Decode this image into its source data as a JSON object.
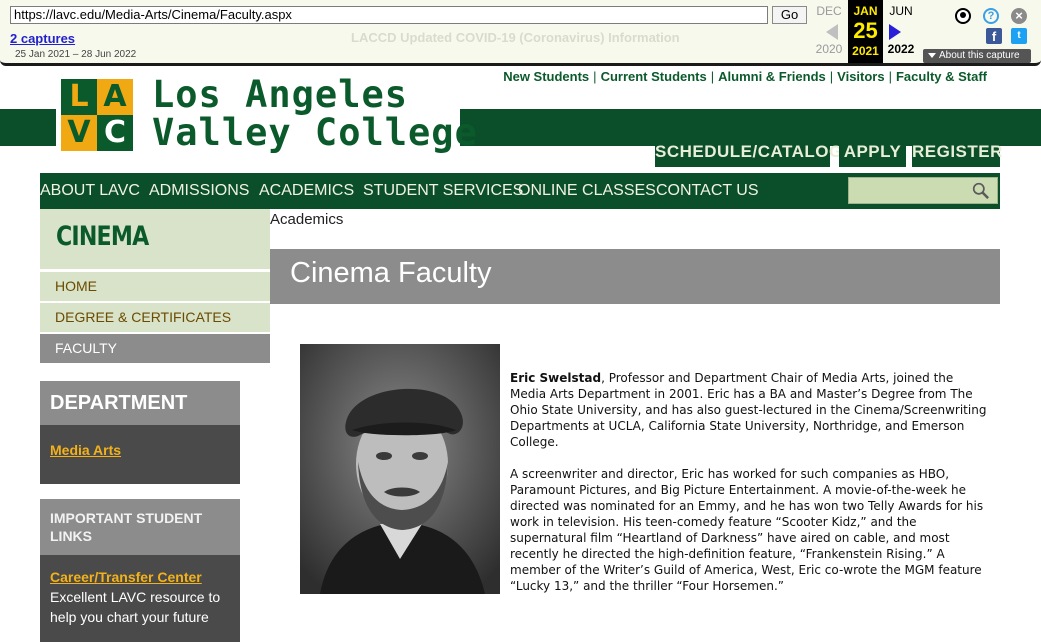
{
  "wayback": {
    "url": "https://lavc.edu/Media-Arts/Cinema/Faculty.aspx",
    "go_label": "Go",
    "captures_label": "2 captures",
    "date_range": "25 Jan 2021 – 28 Jun 2022",
    "notice": "LACCD Updated COVID-19 (Coronavirus) Information",
    "prev": {
      "month": "DEC",
      "year": "2020"
    },
    "current": {
      "month": "JAN",
      "day": "25",
      "year": "2021"
    },
    "next": {
      "month": "JUN",
      "year": "2022"
    },
    "about_label": "About this capture"
  },
  "header": {
    "utility_links": [
      "New Students",
      "Current Students",
      "Alumni & Friends",
      "Visitors",
      "Faculty & Staff"
    ],
    "logo_letters": [
      "L",
      "A",
      "V",
      "C"
    ],
    "college_name_line1": "Los Angeles",
    "college_name_line2": "Valley College",
    "cta": {
      "schedule": "SCHEDULE/CATALOG",
      "apply": "APPLY",
      "register": "REGISTER"
    }
  },
  "main_nav": {
    "items": [
      "ABOUT LAVC",
      "ADMISSIONS",
      "ACADEMICS",
      "STUDENT SERVICES",
      "ONLINE CLASSES",
      "CONTACT US"
    ],
    "search_placeholder": ""
  },
  "sidebar": {
    "section_title": "CINEMA",
    "links": [
      "HOME",
      "DEGREE & CERTIFICATES",
      "FACULTY"
    ],
    "department": {
      "heading": "DEPARTMENT",
      "link": "Media Arts"
    },
    "important_links": {
      "heading": "IMPORTANT STUDENT LINKS",
      "link": "Career/Transfer Center",
      "description": "Excellent LAVC resource to help you chart your future"
    }
  },
  "main": {
    "breadcrumb": "Academics",
    "page_title": "Cinema Faculty",
    "faculty": {
      "name": "Eric Swelstad",
      "intro": ", Professor and Department Chair of Media Arts,  joined the Media Arts Department in 2001.  Eric has a BA and Master’s Degree from The Ohio State University, and has also guest-lectured in the Cinema/Screenwriting Departments at UCLA, California State University, Northridge, and Emerson College.",
      "paragraph2": "A screenwriter and director, Eric has worked for such companies as HBO, Paramount Pictures, and Big Picture Entertainment.  A movie-of-the-week he directed was nominated for an Emmy, and he has won two Telly Awards for his work in television.  His teen-comedy feature “Scooter Kidz,” and the supernatural film “Heartland of Darkness” have aired on cable, and most recently he directed the high-definition feature, “Frankenstein Rising.” A member of the Writer’s Guild of America, West, Eric co-wrote the MGM feature “Lucky 13,” and the thriller “Four Horsemen.”"
    }
  },
  "colors": {
    "brand_green": "#0b4f2a",
    "brand_gold": "#f0a912",
    "sidebar_tint": "#d9e3c9",
    "gray_panel": "#8c8c8c",
    "dark_panel": "#4a4a4a"
  }
}
